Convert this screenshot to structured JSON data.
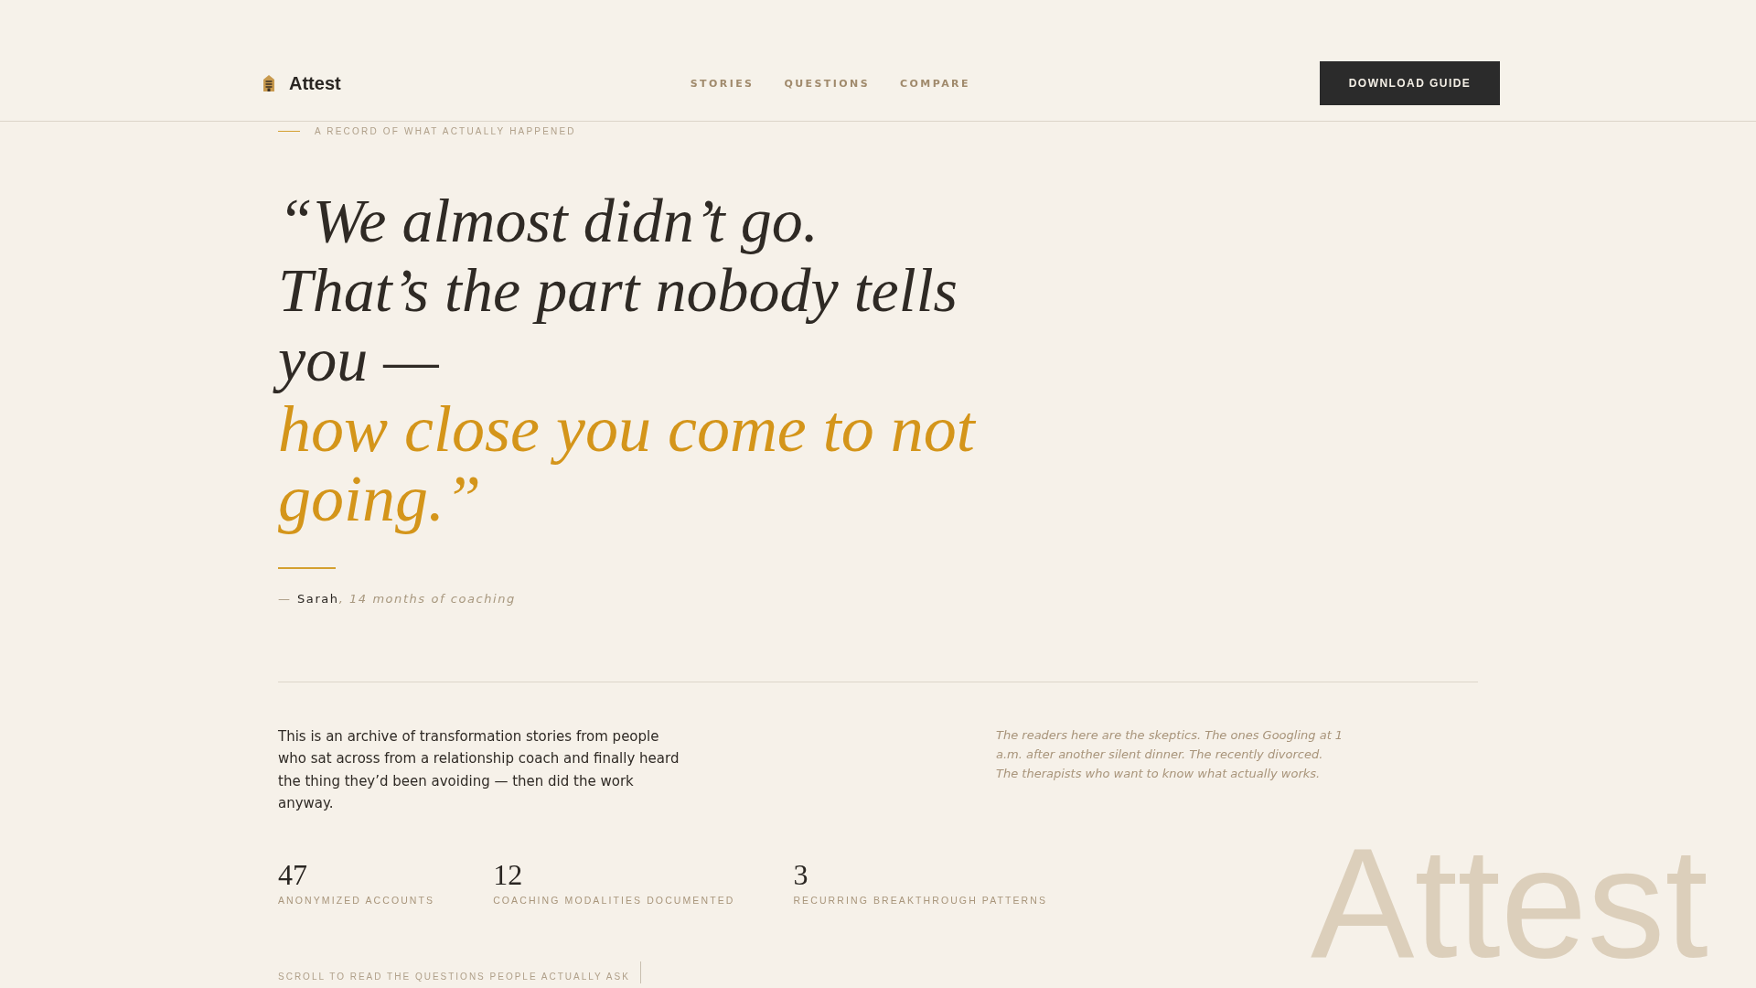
{
  "header": {
    "brand": "Attest",
    "nav": [
      {
        "label": "STORIES"
      },
      {
        "label": "QUESTIONS"
      },
      {
        "label": "COMPARE"
      }
    ],
    "cta": "DOWNLOAD GUIDE"
  },
  "hero": {
    "eyebrow": "A RECORD OF WHAT ACTUALLY HAPPENED",
    "quote": {
      "lines": [
        "“We almost didn’t go.",
        "That’s the part nobody tells you —"
      ],
      "highlight": "how close you come to not going.”"
    },
    "attribution": {
      "dash": "—",
      "name": "Sarah",
      "detail": ", 14 months of coaching"
    }
  },
  "intro": {
    "text": "This is an archive of transformation stories from people who sat across from a relationship coach and finally heard the thing they’d been avoiding — then did the work anyway.",
    "note": "The readers here are the skeptics. The ones Googling at 1 a.m. after another silent dinner. The recently divorced. The therapists who want to know what actually works."
  },
  "stats": [
    {
      "value": "47",
      "label": "ANONYMIZED ACCOUNTS"
    },
    {
      "value": "12",
      "label": "COACHING MODALITIES DOCUMENTED"
    },
    {
      "value": "3",
      "label": "RECURRING BREAKTHROUGH PATTERNS"
    }
  ],
  "scroll_hint": "SCROLL TO READ THE QUESTIONS PEOPLE ACTUALLY ASK",
  "background_word": "Attest"
}
